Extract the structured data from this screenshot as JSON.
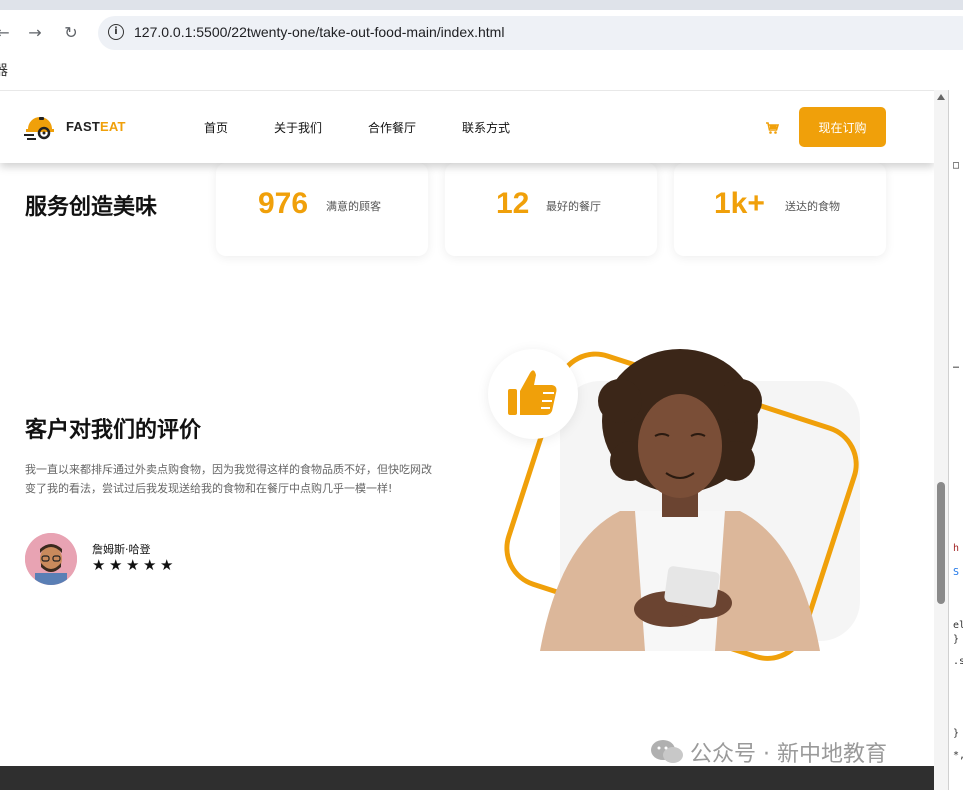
{
  "browser": {
    "url": "127.0.0.1:5500/22twenty-one/take-out-food-main/index.html",
    "bookmark_glyph": "器"
  },
  "header": {
    "logo_part1": "FAST",
    "logo_part2": "EAT",
    "nav": [
      "首页",
      "关于我们",
      "合作餐厅",
      "联系方式"
    ],
    "order_button": "现在订购"
  },
  "stats": {
    "title": "服务创造美味",
    "items": [
      {
        "number": "976",
        "label": "满意的顾客"
      },
      {
        "number": "12",
        "label": "最好的餐厅"
      },
      {
        "number": "1k+",
        "label": "送达的食物"
      }
    ]
  },
  "review": {
    "title": "客户对我们的评价",
    "text": "我一直以来都排斥通过外卖点购食物，因为我觉得这样的食物品质不好，但快吃网改变了我的看法，尝试过后我发现送给我的食物和在餐厅中点购几乎一模一样!",
    "reviewer": "詹姆斯·哈登",
    "rating": 5
  },
  "watermark": "公众号 · 新中地教育",
  "devtools": [
    "□",
    "…",
    "h",
    "S",
    "el",
    "}",
    ".s",
    "}",
    "*,"
  ],
  "colors": {
    "accent": "#f0a00a",
    "footer": "#2f2f2f"
  }
}
